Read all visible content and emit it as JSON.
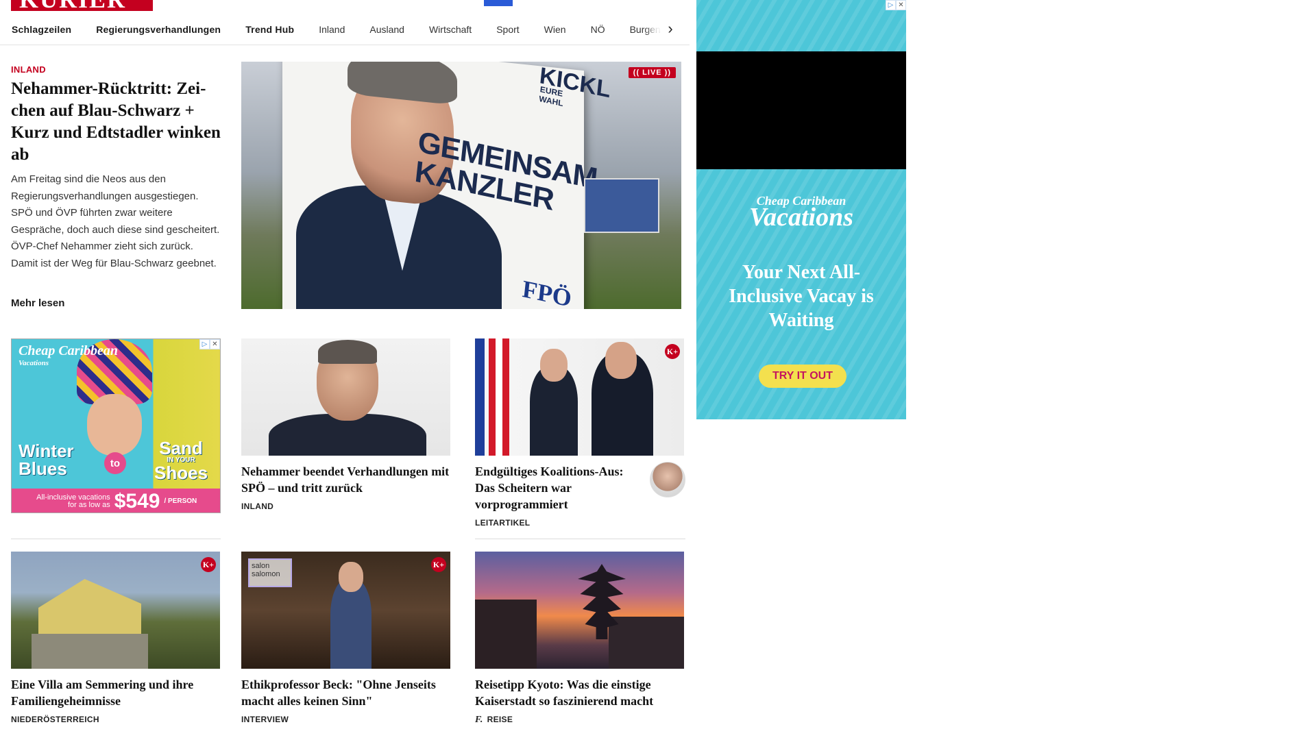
{
  "brand": {
    "logo_text": "KURIER",
    "accent_color": "#c4001f"
  },
  "nav": {
    "items": [
      {
        "label": "Schlagzeilen"
      },
      {
        "label": "Regierungsverhandlungen"
      },
      {
        "label": "Trend Hub"
      },
      {
        "label": "Inland"
      },
      {
        "label": "Ausland"
      },
      {
        "label": "Wirtschaft"
      },
      {
        "label": "Sport"
      },
      {
        "label": "Wien"
      },
      {
        "label": "NÖ"
      },
      {
        "label": "Burgenland"
      }
    ],
    "next_icon": "chevron-right-icon"
  },
  "hero": {
    "kicker": "INLAND",
    "title": "Nehammer-Rücktritt: Zei­chen auf Blau-Schwarz + Kurz und Edtstadler win­ken ab",
    "text": "Am Freitag sind die Neos aus den Regierungsverhandlungen ausgestiegen. SPÖ und ÖVP führten zwar weitere Gespräche, doch auch diese sind gescheitert. ÖVP-Chef Nehammer zieht sich zurück. Damit ist der Weg für Blau-Schwarz geebnet.",
    "more": "Mehr lesen",
    "live_badge": "(( LIVE ))",
    "poster": {
      "kickl": "KICKL",
      "eure_wahl": "EURE WAHL",
      "slogan": "GEMEINSAM KANZLER",
      "party": "FPÖ"
    }
  },
  "articles": {
    "row1": [
      {
        "title": "Nehammer beendet Verhandlungen mit SPÖ – und tritt zurück",
        "category": "INLAND",
        "premium": false
      },
      {
        "title": "Endgültiges Koalitions-Aus: Das Scheitern war vorprogrammiert",
        "category": "LEITARTIKEL",
        "premium": true
      }
    ],
    "row2": [
      {
        "title": "Eine Villa am Semmering und ihre Familiengeheimnisse",
        "category": "NIEDERÖSTERREICH",
        "premium": true
      },
      {
        "title": "Ethikprofessor Beck: \"Ohne Jen­seits macht alles keinen Sinn\"",
        "category": "INTERVIEW",
        "premium": true,
        "image_text": "salon salomon"
      },
      {
        "title": "Reisetipp Kyoto: Was die einstige Kaiserstadt so faszinierend macht",
        "category": "REISE",
        "premium": false,
        "category_icon": "freizeit-icon"
      }
    ],
    "premium_badge": "K+"
  },
  "ads": {
    "small": {
      "brand": "Cheap Caribbean",
      "brand_sub": "Vacations",
      "left_text": "Winter Blues",
      "connector": "to",
      "right_text": "Sand",
      "right_sub": "IN YOUR",
      "right_text2": "Shoes",
      "offer_text": "All-inclusive vacations for as low as",
      "price": "$549",
      "per": "/ PERSON",
      "adchoices_icon": "▷",
      "close_icon": "✕"
    },
    "right": {
      "brand": "Cheap Caribbean",
      "brand_sub": "Vacations",
      "headline": "Your Next All-Inclusive Vacay is Waiting",
      "cta": "TRY IT OUT",
      "adchoices_icon": "▷",
      "close_icon": "✕"
    }
  }
}
